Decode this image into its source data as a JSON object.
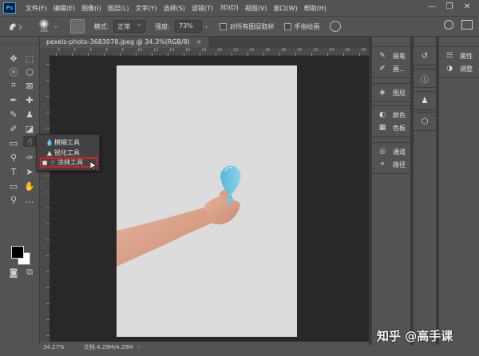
{
  "app": {
    "logo": "Ps",
    "menu": [
      "文件(F)",
      "编辑(E)",
      "图像(I)",
      "图层(L)",
      "文字(Y)",
      "选择(S)",
      "滤镜(T)",
      "3D(D)",
      "视图(V)",
      "窗口(W)",
      "帮助(H)"
    ],
    "window_controls": [
      "—",
      "❐",
      "✕"
    ]
  },
  "options": {
    "brush_size": "105",
    "mode_label": "模式:",
    "mode_value": "正常",
    "strength_label": "强度:",
    "strength_value": "73%",
    "sample_all_label": "对所有图层取样",
    "finger_paint_label": "手指绘画"
  },
  "document": {
    "tab_title": "pexels-photo-3683078.jpeg @ 34.3%(RGB/8)",
    "close": "×",
    "zoom": "34.27%",
    "doc_size": "文档:4.29M/4.29M",
    "status_arrow": "›"
  },
  "ruler": {
    "h_labels": [
      "0",
      "2",
      "4",
      "6",
      "8",
      "10",
      "12",
      "14",
      "16",
      "18",
      "20",
      "22",
      "24",
      "26",
      "28",
      "30",
      "32",
      "34",
      "36",
      "38"
    ]
  },
  "flyout": {
    "items": [
      {
        "label": "模糊工具",
        "icon": "blur-icon",
        "glyph": "💧",
        "selected": false
      },
      {
        "label": "锐化工具",
        "icon": "sharpen-icon",
        "glyph": "▲",
        "selected": false
      },
      {
        "label": "涂抹工具",
        "icon": "smudge-icon",
        "glyph": "☝",
        "selected": true
      }
    ],
    "bullet": "■"
  },
  "panels": {
    "col1": [
      [
        {
          "label": "画笔",
          "icon": "brush-icon",
          "glyph": "✎"
        },
        {
          "label": "画...",
          "icon": "brush-settings-icon",
          "glyph": "✐"
        }
      ],
      [
        {
          "label": "图层",
          "icon": "layers-icon",
          "glyph": "◈"
        }
      ],
      [
        {
          "label": "颜色",
          "icon": "color-icon",
          "glyph": "◐"
        },
        {
          "label": "色板",
          "icon": "swatches-icon",
          "glyph": "▦"
        }
      ],
      [
        {
          "label": "通道",
          "icon": "channels-icon",
          "glyph": "◎"
        },
        {
          "label": "路径",
          "icon": "paths-icon",
          "glyph": "⌖"
        }
      ]
    ],
    "col2": [
      [
        {
          "icon": "history-icon",
          "glyph": "↺"
        }
      ],
      [
        {
          "icon": "info-icon",
          "glyph": "ⓘ"
        }
      ],
      [
        {
          "icon": "clone-source-icon",
          "glyph": "♟"
        }
      ],
      [
        {
          "icon": "3d-icon",
          "glyph": "⬡"
        }
      ]
    ],
    "col3": [
      [
        {
          "label": "属性",
          "icon": "properties-icon",
          "glyph": "☷"
        },
        {
          "label": "调整",
          "icon": "adjustments-icon",
          "glyph": "◑"
        }
      ]
    ]
  },
  "watermark": "知乎 @高手课"
}
